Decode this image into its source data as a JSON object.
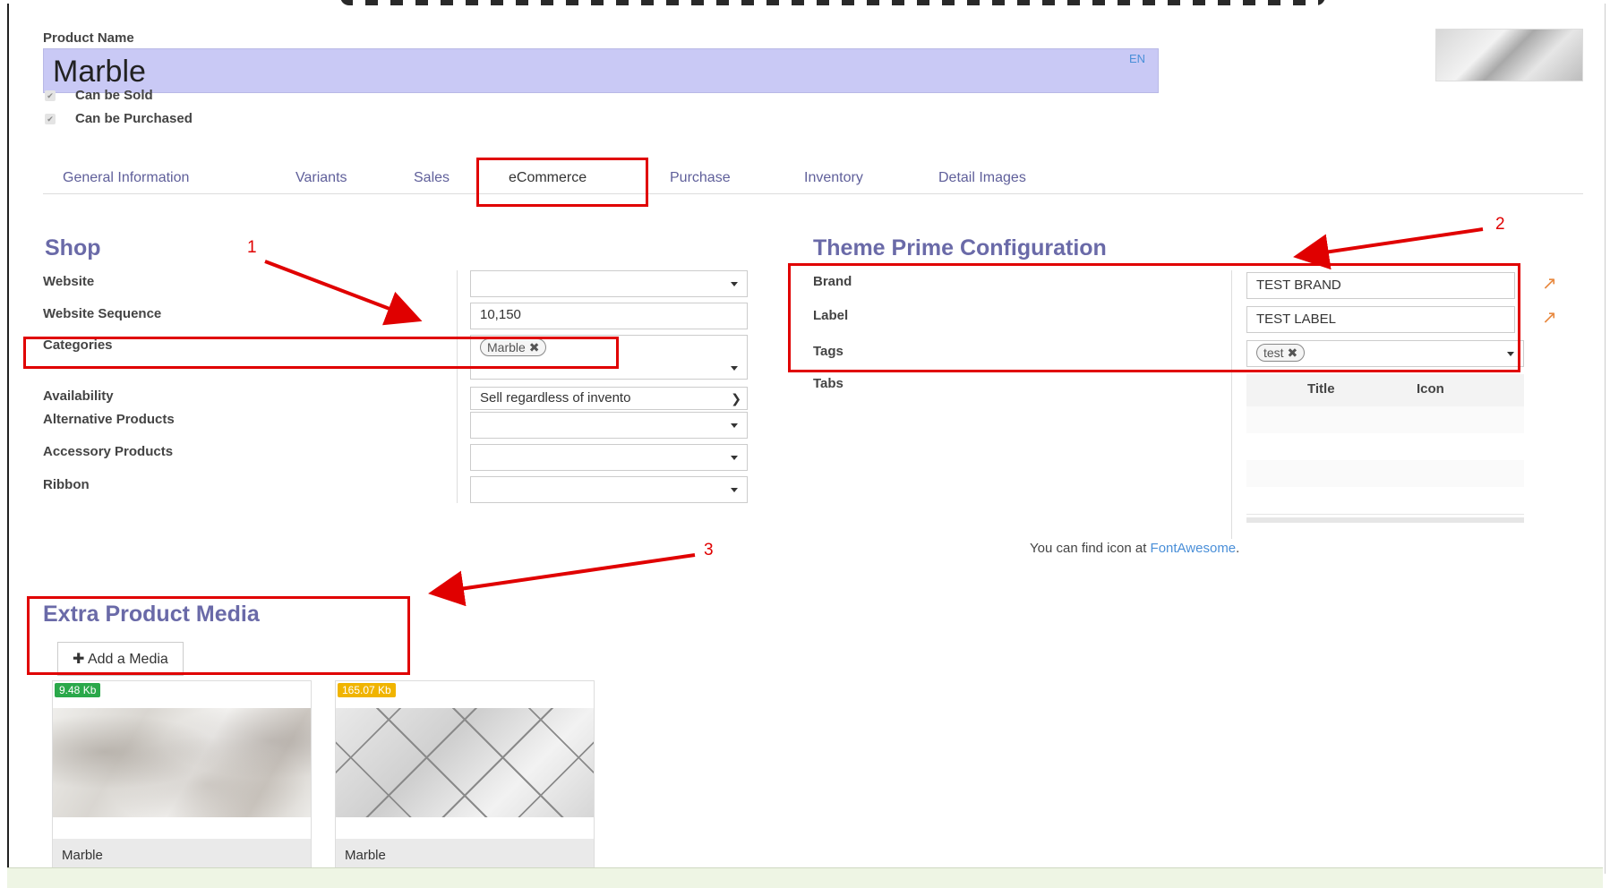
{
  "product": {
    "name_label": "Product Name",
    "name_value": "Marble",
    "lang_badge": "EN",
    "can_be_sold_label": "Can be Sold",
    "can_be_purchased_label": "Can be Purchased"
  },
  "tabs": [
    {
      "label": "General Information"
    },
    {
      "label": "Variants"
    },
    {
      "label": "Sales"
    },
    {
      "label": "eCommerce",
      "active": true
    },
    {
      "label": "Purchase"
    },
    {
      "label": "Inventory"
    },
    {
      "label": "Detail Images"
    }
  ],
  "shop": {
    "title": "Shop",
    "website_label": "Website",
    "website_value": "",
    "sequence_label": "Website Sequence",
    "sequence_value": "10,150",
    "categories_label": "Categories",
    "categories_tag": "Marble",
    "availability_label": "Availability",
    "availability_value": "Sell regardless of invento",
    "alternative_label": "Alternative Products",
    "accessory_label": "Accessory Products",
    "ribbon_label": "Ribbon"
  },
  "theme": {
    "title": "Theme Prime Configuration",
    "brand_label": "Brand",
    "brand_value": "TEST BRAND",
    "label_label": "Label",
    "label_value": "TEST LABEL",
    "tags_label": "Tags",
    "tags_tag": "test",
    "tabs_label": "Tabs",
    "table_headers": [
      "Title",
      "Icon"
    ],
    "hint_text": "You can find icon at ",
    "hint_link": "FontAwesome",
    "hint_end": "."
  },
  "annotations": [
    "1",
    "2",
    "3"
  ],
  "media": {
    "title": "Extra Product Media",
    "add_button": "Add a Media",
    "items": [
      {
        "size": "9.48 Kb",
        "size_color": "#2aa84a",
        "caption": "Marble"
      },
      {
        "size": "165.07 Kb",
        "size_color": "#f0b400",
        "caption": "Marble"
      }
    ]
  },
  "colors": {
    "annotation": "#e00000",
    "heading": "#6a6aa8",
    "name_bg": "#c9c9f5"
  }
}
